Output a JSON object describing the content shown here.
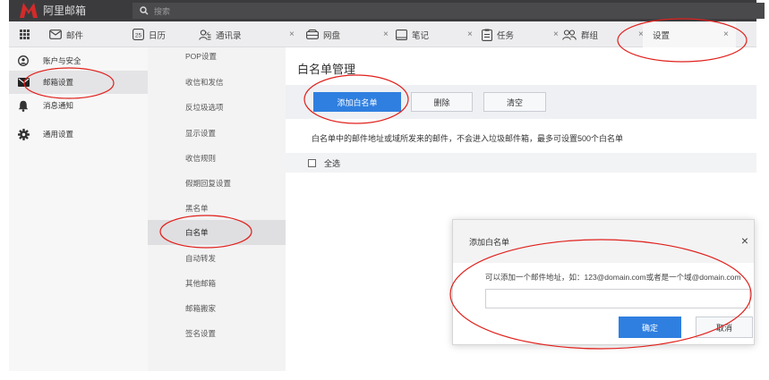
{
  "app": {
    "logo_text": "阿里邮箱",
    "logo_color": "#d42a2a"
  },
  "search": {
    "placeholder": "搜索"
  },
  "tabs": [
    {
      "label": "邮件",
      "icon": "mail-icon"
    },
    {
      "label": "日历",
      "icon": "calendar-icon",
      "icon_text": "25"
    },
    {
      "label": "通讯录",
      "icon": "contacts-icon"
    },
    {
      "label": "网盘",
      "icon": "cloud-drive-icon"
    },
    {
      "label": "笔记",
      "icon": "note-icon"
    },
    {
      "label": "任务",
      "icon": "task-icon"
    },
    {
      "label": "群组",
      "icon": "group-icon"
    },
    {
      "label": "设置",
      "icon": "",
      "active": true
    }
  ],
  "tab_close_glyph": "×",
  "leftnav": {
    "items": [
      {
        "label": "账户与安全",
        "icon": "user-icon"
      },
      {
        "label": "邮箱设置",
        "icon": "envelope-icon",
        "selected": true
      },
      {
        "label": "消息通知",
        "icon": "bell-icon"
      },
      {
        "label": "通用设置",
        "icon": "gear-icon"
      }
    ]
  },
  "subnav": {
    "items": [
      {
        "label": "POP设置"
      },
      {
        "label": "收信和发信"
      },
      {
        "label": "反垃圾选项"
      },
      {
        "label": "显示设置"
      },
      {
        "label": "收信规则"
      },
      {
        "label": "假期回复设置"
      },
      {
        "label": "黑名单"
      },
      {
        "label": "白名单",
        "selected": true
      },
      {
        "label": "自动转发"
      },
      {
        "label": "其他邮箱"
      },
      {
        "label": "邮箱搬家"
      },
      {
        "label": "签名设置"
      }
    ]
  },
  "main": {
    "title": "白名单管理",
    "buttons": {
      "add": "添加白名单",
      "delete": "删除",
      "clear": "清空"
    },
    "info": "白名单中的邮件地址或域所发来的邮件，不会进入垃圾邮件箱，最多可设置500个白名单",
    "select_all": "全选"
  },
  "dialog": {
    "title": "添加白名单",
    "close": "×",
    "hint": "可以添加一个邮件地址，如：123@domain.com或者是一个域@domain.com",
    "input_value": "",
    "ok": "确定",
    "cancel": "取消"
  },
  "colors": {
    "accent": "#2f7fe0",
    "annotation": "#e0201b"
  }
}
